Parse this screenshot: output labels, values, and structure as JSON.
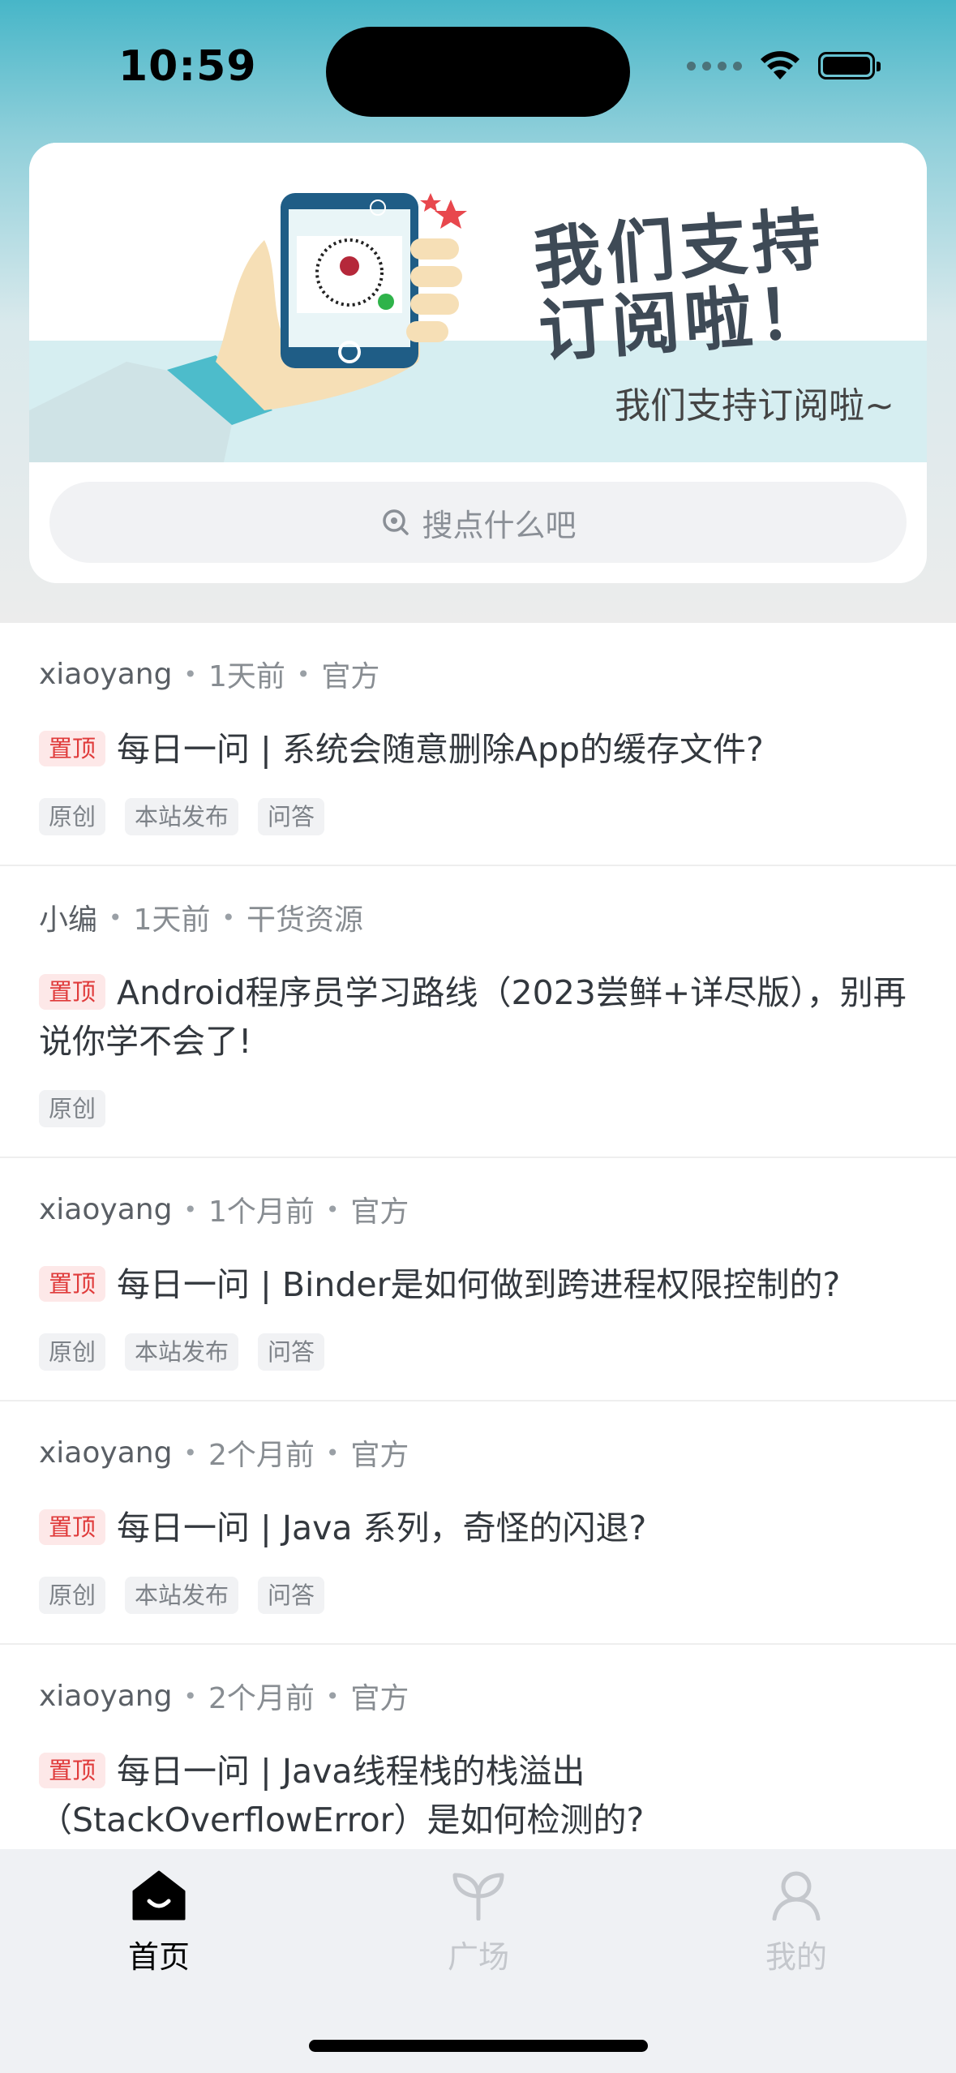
{
  "status_bar": {
    "time": "10:59"
  },
  "banner": {
    "headline_line1": "我们支持",
    "headline_line2": "订阅啦！",
    "subtitle": "我们支持订阅啦~"
  },
  "search": {
    "placeholder": "搜点什么吧"
  },
  "feed": [
    {
      "author": "xiaoyang",
      "time": "1天前",
      "category": "官方",
      "pin": "置顶",
      "title": "每日一问 | 系统会随意删除App的缓存文件?",
      "tags": [
        "原创",
        "本站发布",
        "问答"
      ]
    },
    {
      "author": "小编",
      "time": "1天前",
      "category": "干货资源",
      "pin": "置顶",
      "title": "Android程序员学习路线（2023尝鲜+详尽版），别再说你学不会了!",
      "tags": [
        "原创"
      ]
    },
    {
      "author": "xiaoyang",
      "time": "1个月前",
      "category": "官方",
      "pin": "置顶",
      "title": "每日一问 | Binder是如何做到跨进程权限控制的?",
      "tags": [
        "原创",
        "本站发布",
        "问答"
      ]
    },
    {
      "author": "xiaoyang",
      "time": "2个月前",
      "category": "官方",
      "pin": "置顶",
      "title": "每日一问 | Java 系列，奇怪的闪退?",
      "tags": [
        "原创",
        "本站发布",
        "问答"
      ]
    },
    {
      "author": "xiaoyang",
      "time": "2个月前",
      "category": "官方",
      "pin": "置顶",
      "title": "每日一问 | Java线程栈的栈溢出（StackOverflowError）是如何检测的?",
      "tags": []
    }
  ],
  "tabbar": {
    "items": [
      {
        "label": "首页",
        "icon": "home-icon",
        "active": true
      },
      {
        "label": "广场",
        "icon": "sprout-icon",
        "active": false
      },
      {
        "label": "我的",
        "icon": "person-icon",
        "active": false
      }
    ],
    "active_color": "#000000",
    "inactive_color": "#c4c7cc"
  },
  "colors": {
    "pin_bg": "#fde8e8",
    "pin_text": "#e03b3b",
    "header_gradient_top": "#47b6c8"
  }
}
